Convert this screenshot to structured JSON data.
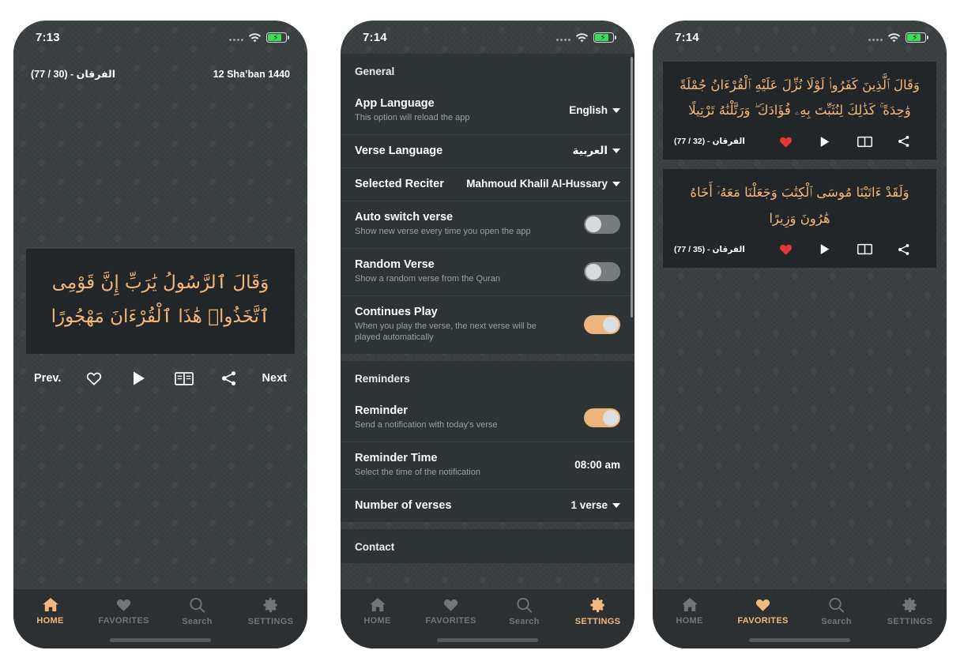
{
  "app": {
    "accent": "#f0b97e",
    "verse_color": "#f2b87b",
    "heart_fav_color": "#e23a35",
    "screen_bg": "#383d40",
    "card_bg": "#222628"
  },
  "tabs": {
    "home": "HOME",
    "favorites": "FAVORITES",
    "search": "Search",
    "settings": "SETTINGS"
  },
  "home": {
    "status": {
      "time": "7:13"
    },
    "surah_ref": "الفرقان - (30 / 77)",
    "hijri_date": "12 Sha’ban 1440",
    "verse_arabic": "وَقَالَ ٱلرَّسُولُ يَٰرَبِّ إِنَّ قَوْمِى ٱتَّخَذُوا۟ هَٰذَا ٱلْقُرْءَانَ مَهْجُورًا",
    "prev_label": "Prev.",
    "next_label": "Next",
    "actions": [
      "favorite-outline",
      "play",
      "book",
      "share"
    ]
  },
  "settings": {
    "status": {
      "time": "7:14"
    },
    "sections": [
      {
        "title": "General",
        "rows": [
          {
            "title": "App Language",
            "sub": "This option will reload the app",
            "value": "English",
            "control": "dropdown"
          },
          {
            "title": "Verse Language",
            "sub": "",
            "value": "العربية",
            "control": "dropdown-rtl"
          },
          {
            "title": "Selected Reciter",
            "sub": "",
            "value": "Mahmoud Khalil Al-Hussary",
            "control": "dropdown-multiline"
          },
          {
            "title": "Auto switch verse",
            "sub": "Show new verse every time you open the app",
            "value": "",
            "control": "toggle-off"
          },
          {
            "title": "Random Verse",
            "sub": "Show a random verse from the Quran",
            "value": "",
            "control": "toggle-off"
          },
          {
            "title": "Continues Play",
            "sub": "When you play the verse, the next verse will be played automatically",
            "value": "",
            "control": "toggle-on"
          }
        ]
      },
      {
        "title": "Reminders",
        "rows": [
          {
            "title": "Reminder",
            "sub": "Send a notification with today's verse",
            "value": "",
            "control": "toggle-on"
          },
          {
            "title": "Reminder Time",
            "sub": "Select the time of the notification",
            "value": "08:00 am",
            "control": "text"
          },
          {
            "title": "Number of verses",
            "sub": "",
            "value": "1 verse",
            "control": "dropdown"
          }
        ]
      },
      {
        "title": "Contact",
        "rows": []
      }
    ]
  },
  "favorites": {
    "status": {
      "time": "7:14"
    },
    "cards": [
      {
        "verse_arabic": "وَقَالَ ٱلَّذِينَ كَفَرُوا۟ لَوْلَا نُزِّلَ عَلَيْهِ ٱلْقُرْءَانُ جُمْلَةً وَٰحِدَةً ۚ كَذَٰلِكَ لِنُثَبِّتَ بِهِۦ فُؤَادَكَ ۖ وَرَتَّلْنَٰهُ تَرْتِيلًا",
        "ref": "الفرقان - (32 / 77)"
      },
      {
        "verse_arabic": "وَلَقَدْ ءَاتَيْنَا مُوسَى ٱلْكِتَٰبَ وَجَعَلْنَا مَعَهُۥٓ أَخَاهُ هَٰرُونَ وَزِيرًا",
        "ref": "الفرقان - (35 / 77)"
      }
    ]
  }
}
